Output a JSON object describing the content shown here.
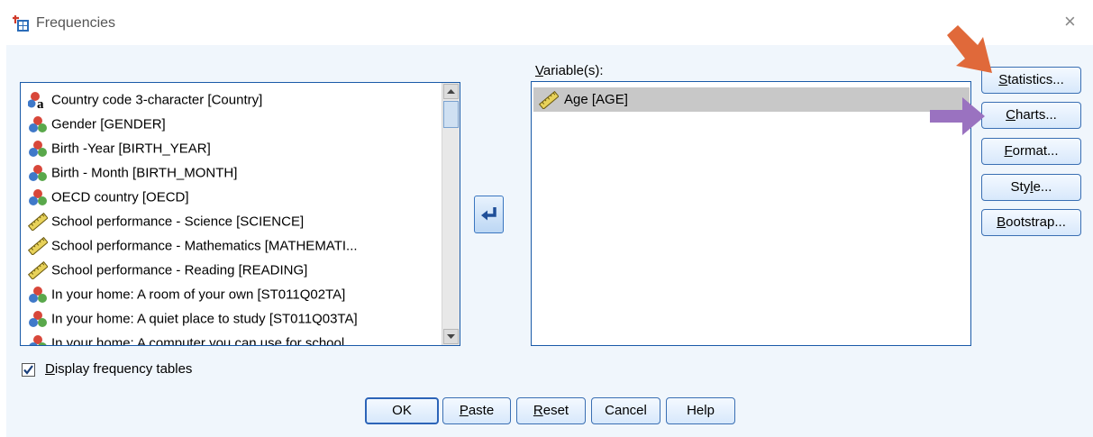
{
  "window": {
    "title": "Frequencies",
    "close_glyph": "×"
  },
  "source_list": {
    "items": [
      {
        "label": "Country code 3-character [Country]",
        "icon": "nominal-string-icon"
      },
      {
        "label": "Gender [GENDER]",
        "icon": "nominal-icon"
      },
      {
        "label": "Birth -Year [BIRTH_YEAR]",
        "icon": "nominal-icon"
      },
      {
        "label": "Birth - Month [BIRTH_MONTH]",
        "icon": "nominal-icon"
      },
      {
        "label": "OECD country [OECD]",
        "icon": "nominal-icon"
      },
      {
        "label": "School performance - Science [SCIENCE]",
        "icon": "scale-ruler-icon"
      },
      {
        "label": "School performance - Mathematics [MATHEMATI...",
        "icon": "scale-ruler-icon"
      },
      {
        "label": "School performance - Reading [READING]",
        "icon": "scale-ruler-icon"
      },
      {
        "label": "In your home: A room of your own [ST011Q02TA]",
        "icon": "nominal-icon"
      },
      {
        "label": "In your home: A quiet place to study [ST011Q03TA]",
        "icon": "nominal-icon"
      },
      {
        "label": "In your home: A computer you can use for school",
        "icon": "nominal-icon"
      }
    ]
  },
  "target": {
    "label_mnemonic": "V",
    "label_rest": "ariable(s):",
    "items": [
      {
        "label": "Age [AGE]",
        "icon": "scale-ruler-icon"
      }
    ]
  },
  "side_buttons": {
    "statistics": {
      "mnemonic": "S",
      "rest": "tatistics..."
    },
    "charts": {
      "mnemonic": "C",
      "rest": "harts..."
    },
    "format": {
      "mnemonic": "F",
      "rest": "ormat..."
    },
    "style": {
      "pre": "Sty",
      "mnemonic": "l",
      "rest": "e..."
    },
    "bootstrap": {
      "mnemonic": "B",
      "rest": "ootstrap..."
    }
  },
  "options": {
    "display_freq_mnemonic": "D",
    "display_freq_rest": "isplay frequency tables",
    "display_freq_checked": true
  },
  "bottom_buttons": {
    "ok": "OK",
    "paste": {
      "mnemonic": "P",
      "rest": "aste"
    },
    "reset": {
      "mnemonic": "R",
      "rest": "eset"
    },
    "cancel": "Cancel",
    "help": "Help"
  },
  "colors": {
    "annotation_arrow_orange": "#e0693a",
    "annotation_arrow_purple": "#9a72c0",
    "accent_blue": "#2c64b8"
  }
}
